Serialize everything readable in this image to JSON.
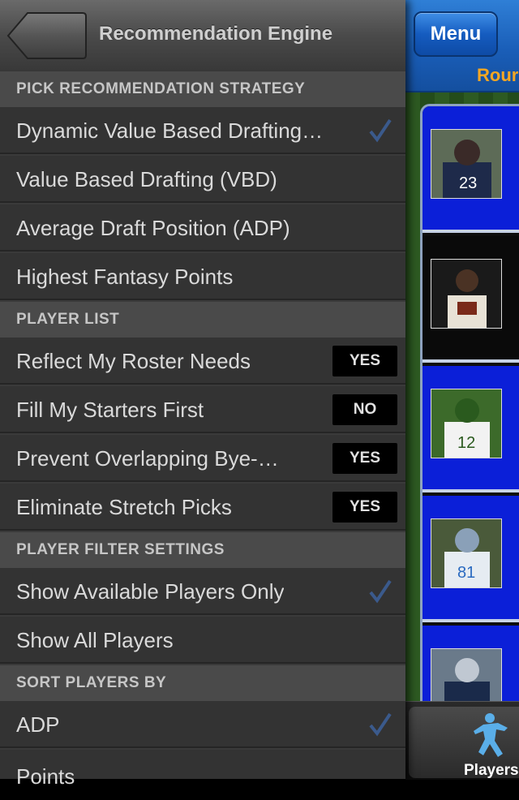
{
  "navbar": {
    "title": "Recommendation Engine"
  },
  "background_app": {
    "menu_label": "Menu",
    "round_label": "Rour",
    "tab_label": "Players",
    "accent": "#1a5eb8",
    "round_color": "#f5a623"
  },
  "sections": {
    "strategy": "PICK RECOMMENDATION STRATEGY",
    "player_list": "PLAYER LIST",
    "filter": "PLAYER FILTER SETTINGS",
    "sort": "SORT PLAYERS BY"
  },
  "strategy_items": [
    {
      "label": "Dynamic Value Based Drafting…",
      "checked": true
    },
    {
      "label": "Value Based Drafting (VBD)",
      "checked": false
    },
    {
      "label": "Average Draft Position (ADP)",
      "checked": false
    },
    {
      "label": "Highest Fantasy Points",
      "checked": false
    }
  ],
  "player_list_items": [
    {
      "label": "Reflect My Roster Needs",
      "value": "YES"
    },
    {
      "label": "Fill My Starters First",
      "value": "NO"
    },
    {
      "label": "Prevent Overlapping Bye-…",
      "value": "YES"
    },
    {
      "label": "Eliminate Stretch Picks",
      "value": "YES"
    }
  ],
  "filter_items": [
    {
      "label": "Show Available Players Only",
      "checked": true
    },
    {
      "label": "Show All Players",
      "checked": false
    }
  ],
  "sort_items": [
    {
      "label": "ADP",
      "checked": true
    },
    {
      "label": "Points",
      "checked": false
    }
  ],
  "colors": {
    "check": "#3b5a8c",
    "panel": "#333333",
    "section": "#4a4a4a"
  },
  "icons": {
    "back": "back-arrow-icon",
    "check": "checkmark-icon",
    "players": "football-player-icon"
  }
}
